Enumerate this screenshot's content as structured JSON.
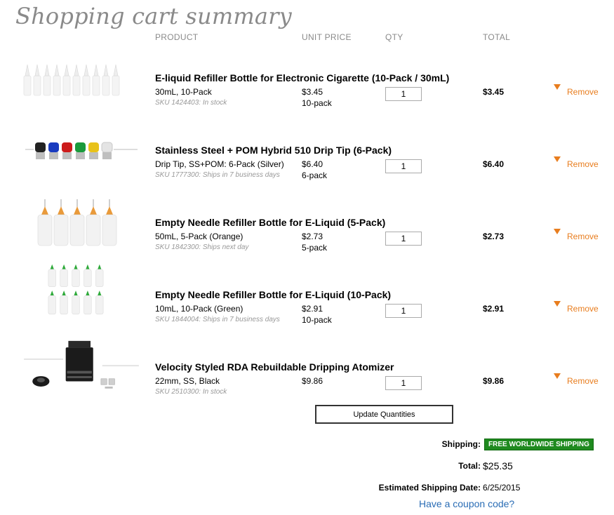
{
  "page_title": "Shopping cart summary",
  "columns": {
    "product": "PRODUCT",
    "unit_price": "UNIT PRICE",
    "qty": "QTY",
    "total": "TOTAL"
  },
  "items": [
    {
      "name": "E-liquid Refiller Bottle for Electronic Cigarette (10-Pack / 30mL)",
      "variant": "30mL, 10-Pack",
      "sku": "SKU 1424403: In stock",
      "price": "$3.45",
      "pack": "10-pack",
      "qty": "1",
      "total": "$3.45",
      "remove": "Remove"
    },
    {
      "name": "Stainless Steel + POM Hybrid 510 Drip Tip (6-Pack)",
      "variant": "Drip Tip, SS+POM: 6-Pack (Silver)",
      "sku": "SKU 1777300: Ships in 7 business days",
      "price": "$6.40",
      "pack": "6-pack",
      "qty": "1",
      "total": "$6.40",
      "remove": "Remove"
    },
    {
      "name": "Empty Needle Refiller Bottle for E-Liquid (5-Pack)",
      "variant": "50mL, 5-Pack (Orange)",
      "sku": "SKU 1842300: Ships next day",
      "price": "$2.73",
      "pack": "5-pack",
      "qty": "1",
      "total": "$2.73",
      "remove": "Remove"
    },
    {
      "name": "Empty Needle Refiller Bottle for E-Liquid (10-Pack)",
      "variant": "10mL, 10-Pack (Green)",
      "sku": "SKU 1844004: Ships in 7 business days",
      "price": "$2.91",
      "pack": "10-pack",
      "qty": "1",
      "total": "$2.91",
      "remove": "Remove"
    },
    {
      "name": "Velocity Styled RDA Rebuildable Dripping Atomizer",
      "variant": "22mm, SS, Black",
      "sku": "SKU 2510300: In stock",
      "price": "$9.86",
      "pack": "",
      "qty": "1",
      "total": "$9.86",
      "remove": "Remove"
    }
  ],
  "update_button": "Update Quantities",
  "summary": {
    "shipping_label": "Shipping:",
    "shipping_value": "FREE WORLDWIDE SHIPPING",
    "total_label": "Total:",
    "total_value": "$25.35",
    "est_label": "Estimated Shipping Date:",
    "est_value": "6/25/2015",
    "coupon": "Have a coupon code?"
  },
  "colors": {
    "accent": "#e87d1e",
    "free_shipping_bg": "#1f8a1f",
    "link": "#2a6db5",
    "muted": "#8a8a8a"
  },
  "icons": {
    "remove": "caret-down-icon"
  }
}
